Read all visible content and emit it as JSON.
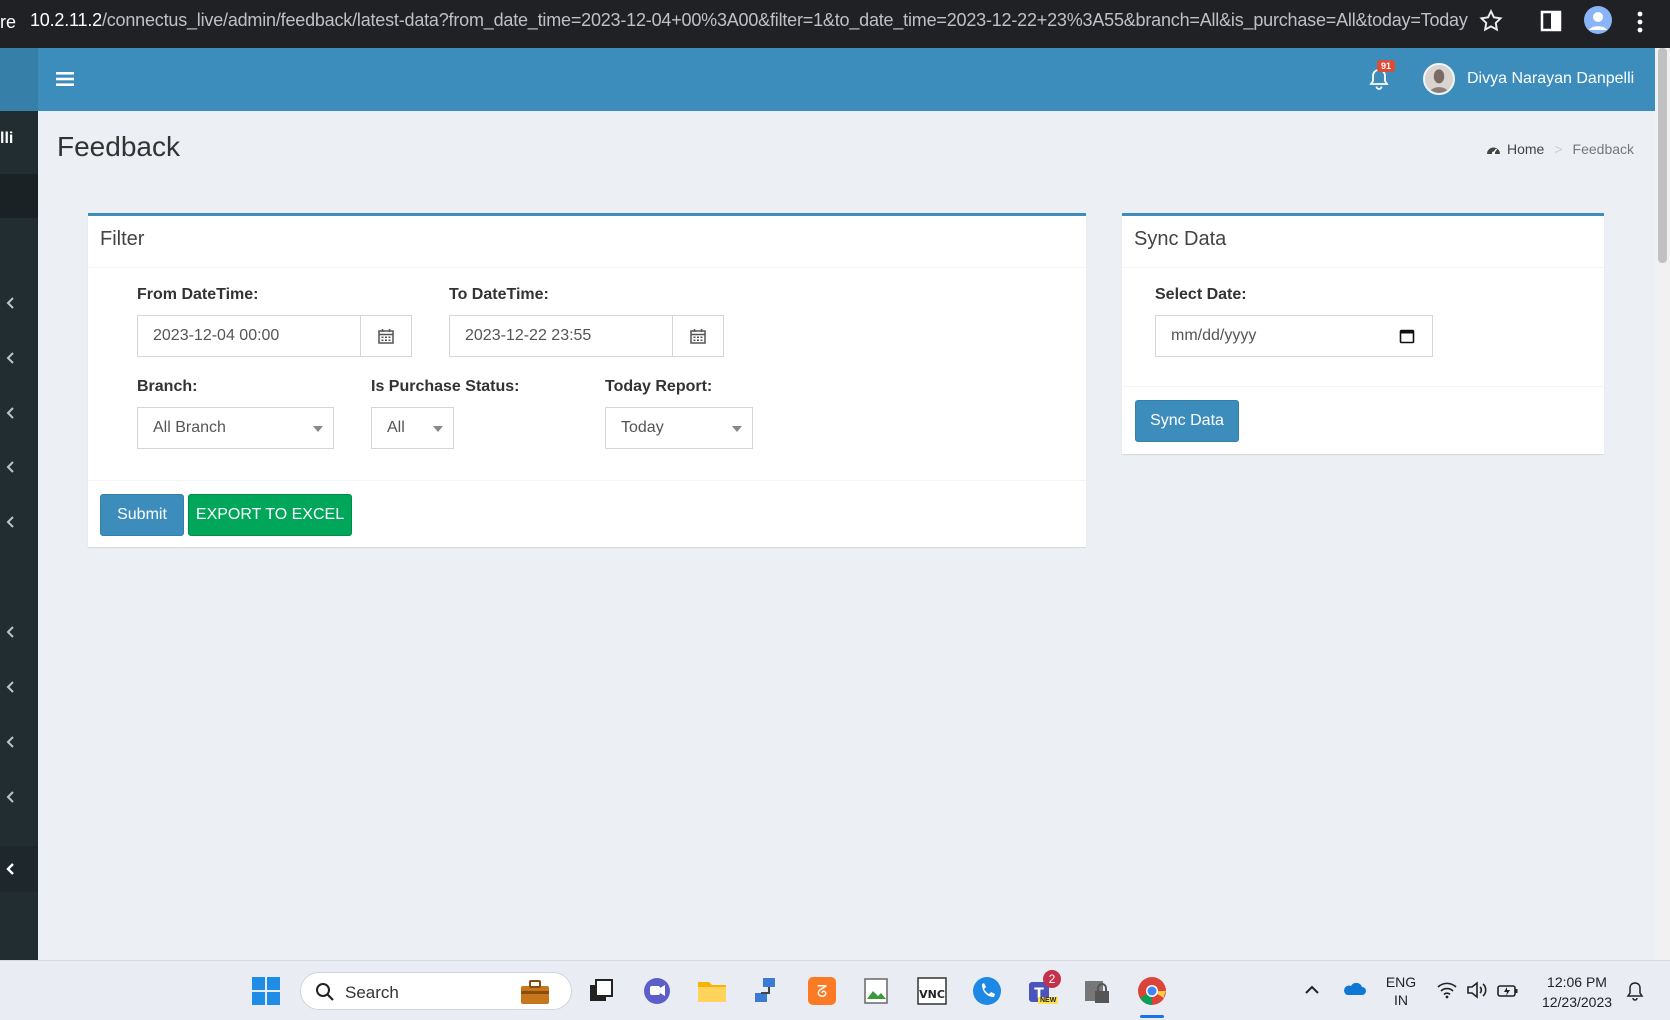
{
  "browser": {
    "url_prefix": "re",
    "url_host": "10.2.11.2",
    "url_path": "/connectus_live/admin/feedback/latest-data?from_date_time=2023-12-04+00%3A00&filter=1&to_date_time=2023-12-22+23%3A55&branch=All&is_purchase=All&today=Today"
  },
  "sidebar": {
    "user_text": "lli"
  },
  "header": {
    "notification_count": "91",
    "user_name": "Divya Narayan Danpelli"
  },
  "page": {
    "title": "Feedback",
    "breadcrumb": {
      "home": "Home",
      "current": "Feedback"
    }
  },
  "filter": {
    "title": "Filter",
    "from_label": "From DateTime:",
    "from_value": "2023-12-04 00:00",
    "to_label": "To DateTime:",
    "to_value": "2023-12-22 23:55",
    "branch_label": "Branch:",
    "branch_value": "All Branch",
    "purchase_label": "Is Purchase Status:",
    "purchase_value": "All",
    "today_label": "Today Report:",
    "today_value": "Today",
    "submit_label": "Submit",
    "export_label": "EXPORT TO EXCEL"
  },
  "sync": {
    "title": "Sync Data",
    "date_label": "Select Date:",
    "date_placeholder": "mm/dd/yyyy",
    "button_label": "Sync Data"
  },
  "taskbar": {
    "search_label": "Search",
    "teams_badge": "2",
    "teams_new": "NEW",
    "lang_1": "ENG",
    "lang_2": "IN",
    "time": "12:06 PM",
    "date": "12/23/2023"
  },
  "colors": {
    "header": "#3c8dbc",
    "sidebar": "#222d32",
    "success": "#00a65a",
    "badge": "#dd4b39"
  }
}
